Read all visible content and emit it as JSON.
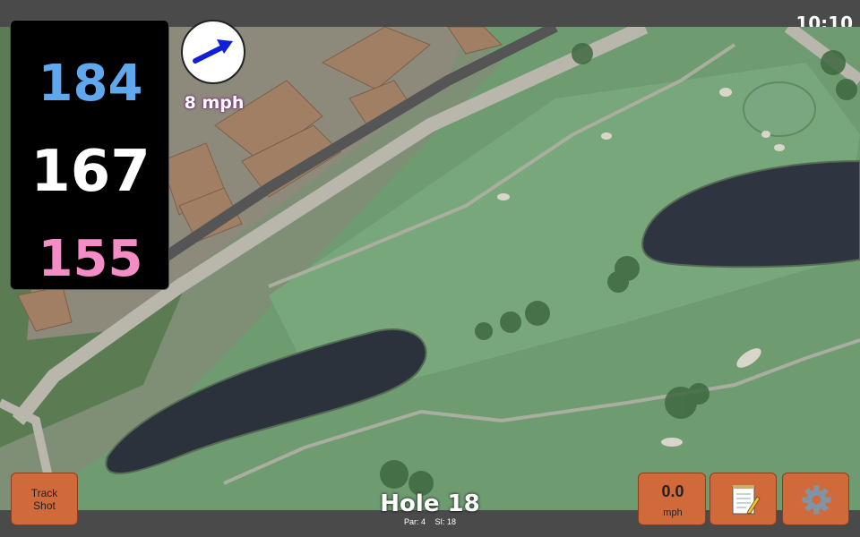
{
  "status": {
    "time": "10:10"
  },
  "distances": {
    "back": "184",
    "middle": "167",
    "front": "155"
  },
  "wind": {
    "speed": "8 mph",
    "icon": "wind-arrow-icon"
  },
  "hole": {
    "title": "Hole 18",
    "par": "Par: 4",
    "si": "SI: 18"
  },
  "buttons": {
    "track_shot_line1": "Track",
    "track_shot_line2": "Shot",
    "speed_value": "0.0",
    "speed_unit": "mph",
    "notes_icon": "notepad-icon",
    "settings_icon": "gear-icon"
  },
  "colors": {
    "back_distance": "#5fa8ee",
    "middle_distance": "#ffffff",
    "front_distance": "#f48cc6",
    "button": "#d16a3a"
  }
}
